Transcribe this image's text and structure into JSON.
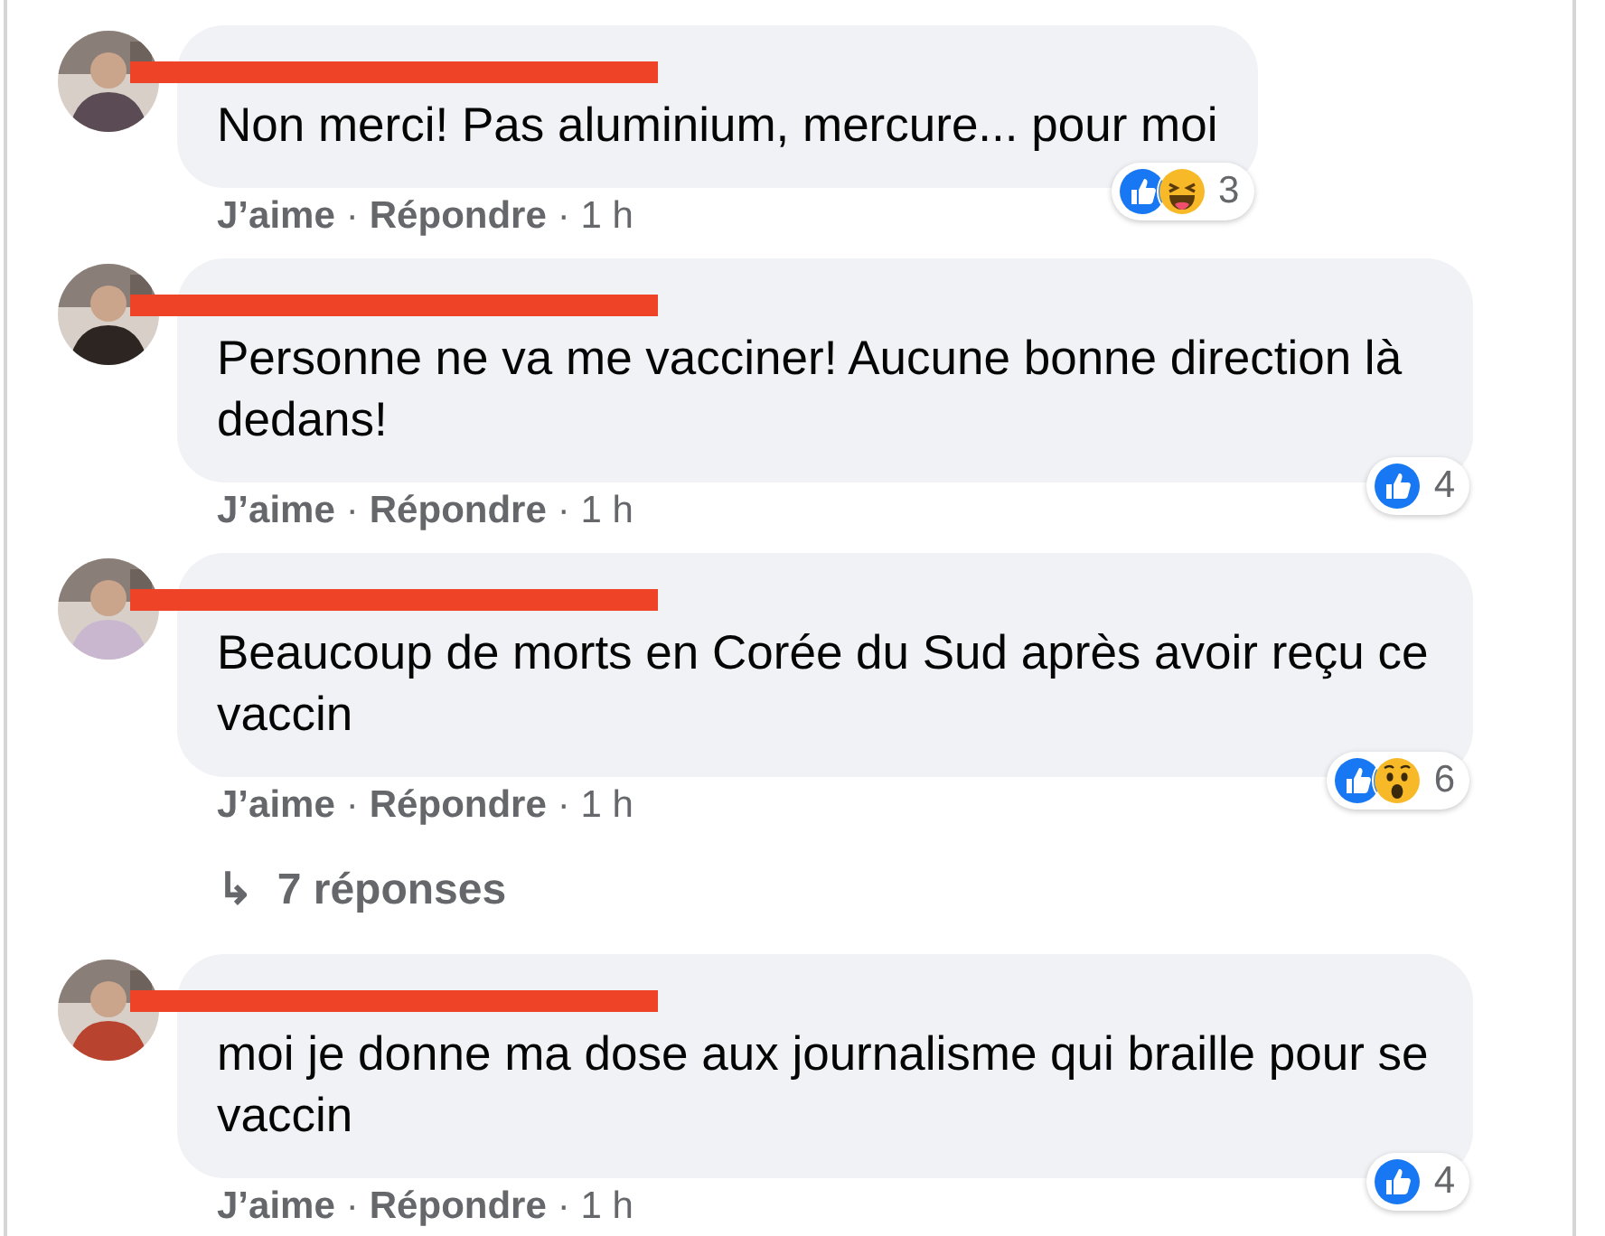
{
  "comments": [
    {
      "name_redacted": true,
      "text": "Non merci! Pas aluminium, mercure... pour moi",
      "reactions": [
        {
          "kind": "like"
        },
        {
          "kind": "haha"
        }
      ],
      "reaction_count": "3",
      "like": "J’aime",
      "separator": "·",
      "reply": "Répondre",
      "time": "· 1 h"
    },
    {
      "name_redacted": true,
      "text": "Personne ne va me vacciner! Aucune bonne direction là dedans!",
      "reactions": [
        {
          "kind": "like"
        }
      ],
      "reaction_count": "4",
      "like": "J’aime",
      "separator": "·",
      "reply": "Répondre",
      "time": "· 1 h"
    },
    {
      "name_redacted": true,
      "text": "Beaucoup de morts en Corée du Sud après avoir reçu ce vaccin",
      "reactions": [
        {
          "kind": "like"
        },
        {
          "kind": "wow"
        }
      ],
      "reaction_count": "6",
      "like": "J’aime",
      "separator": "·",
      "reply": "Répondre",
      "time": "· 1 h",
      "replies": {
        "arrow": "↳",
        "label": "7 réponses"
      }
    },
    {
      "name_redacted": true,
      "text": "moi je donne ma dose aux journalisme qui braille pour se vaccin",
      "reactions": [
        {
          "kind": "like"
        }
      ],
      "reaction_count": "4",
      "like": "J’aime",
      "separator": "·",
      "reply": "Répondre",
      "time": "· 1 h"
    }
  ]
}
